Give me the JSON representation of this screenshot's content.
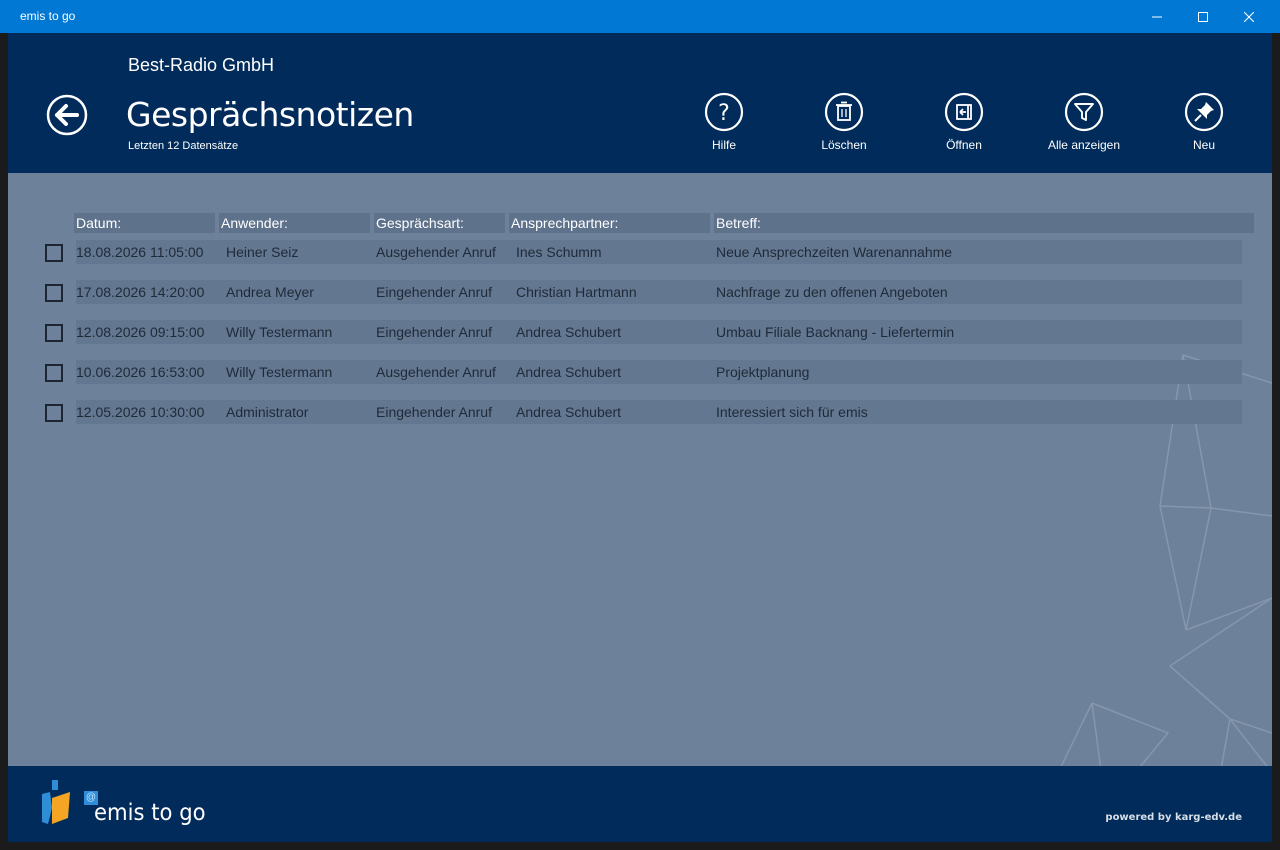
{
  "window": {
    "title": "emis to go"
  },
  "header": {
    "company": "Best-Radio GmbH",
    "title": "Gesprächsnotizen",
    "subtitle": "Letzten 12 Datensätze"
  },
  "toolbar": {
    "help_label": "Hilfe",
    "delete_label": "Löschen",
    "open_label": "Öffnen",
    "show_all_label": "Alle anzeigen",
    "new_label": "Neu"
  },
  "table": {
    "columns": [
      "Datum:",
      "Anwender:",
      "Gesprächsart:",
      "Ansprechpartner:",
      "Betreff:"
    ],
    "rows": [
      [
        "18.08.2026 11:05:00",
        "Heiner Seiz",
        "Ausgehender Anruf",
        "Ines Schumm",
        "Neue Ansprechzeiten Warenannahme"
      ],
      [
        "17.08.2026 14:20:00",
        "Andrea Meyer",
        "Eingehender Anruf",
        "Christian Hartmann",
        "Nachfrage zu den offenen Angeboten"
      ],
      [
        "12.08.2026 09:15:00",
        "Willy Testermann",
        "Eingehender Anruf",
        "Andrea Schubert",
        "Umbau Filiale Backnang - Liefertermin"
      ],
      [
        "10.06.2026 16:53:00",
        "Willy Testermann",
        "Ausgehender Anruf",
        "Andrea Schubert",
        "Projektplanung"
      ],
      [
        "12.05.2026 10:30:00",
        "Administrator",
        "Eingehender Anruf",
        "Andrea Schubert",
        "Interessiert sich für emis"
      ]
    ]
  },
  "footer": {
    "logo_text": "emis to go",
    "logo_at": "@",
    "powered": "powered by karg-edv.de"
  },
  "colors": {
    "titlebar": "#0078d4",
    "header": "#002b5a",
    "content": "#6e819a",
    "logo_orange": "#f5a524",
    "logo_blue": "#2e8fd8"
  }
}
